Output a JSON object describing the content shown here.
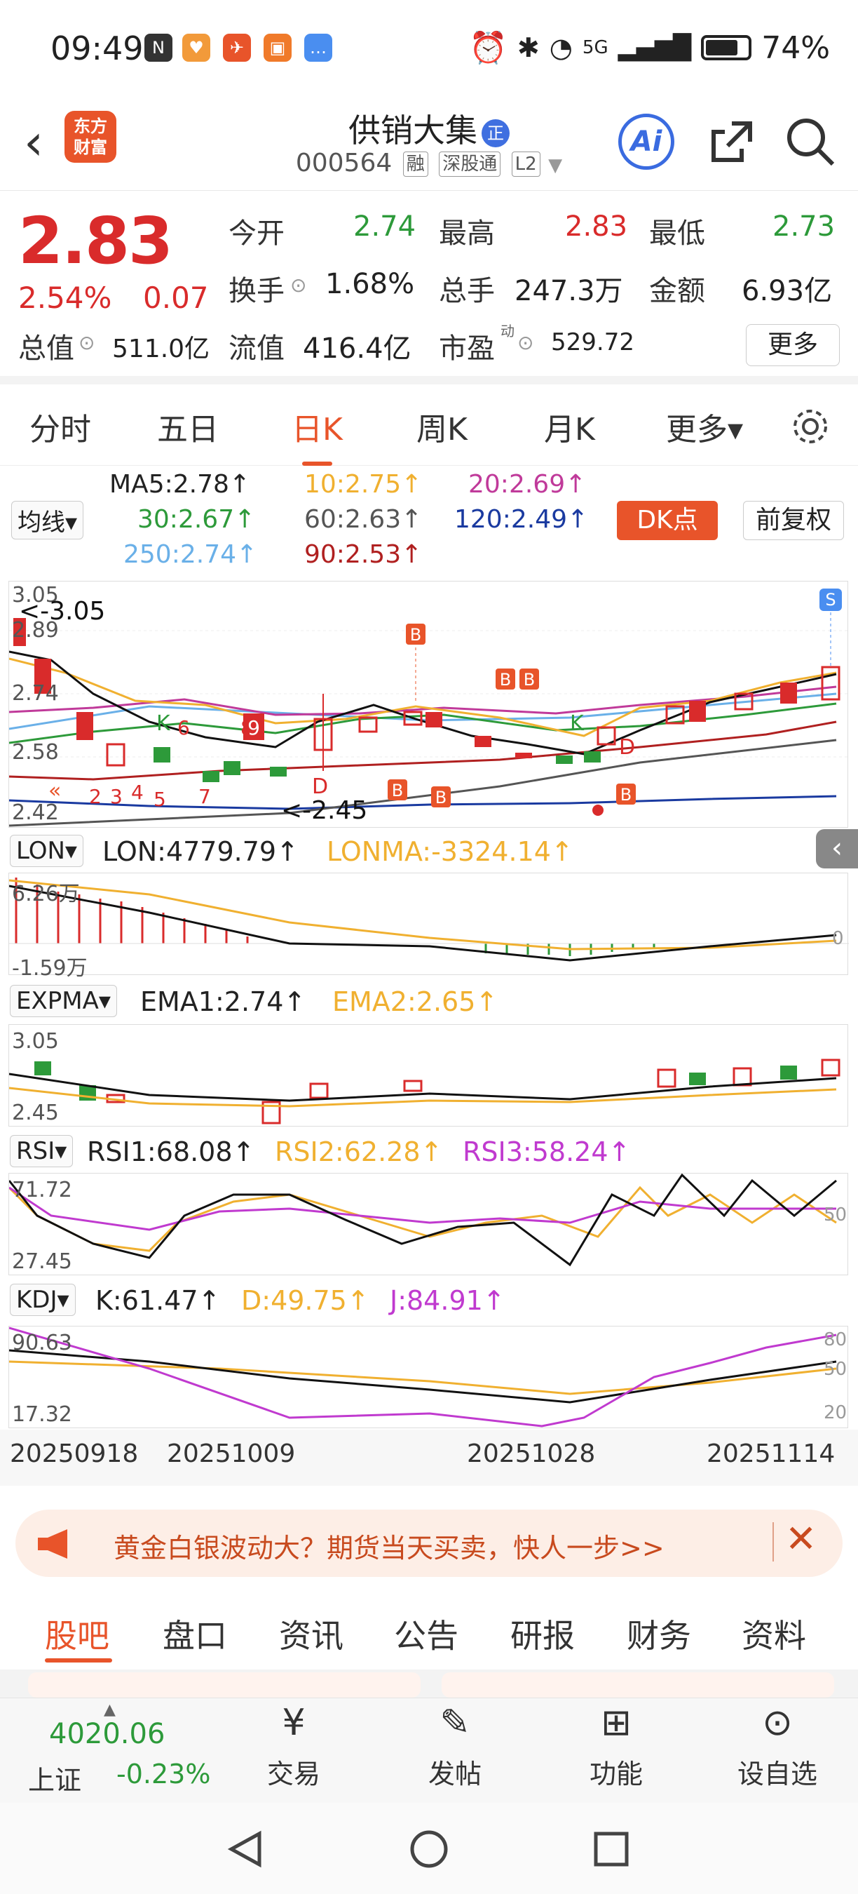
{
  "status_bar": {
    "time": "09:49",
    "network": "5G",
    "battery": "74%"
  },
  "header": {
    "back": "<",
    "logo": "东方\n财富",
    "stock_name": "供销大集",
    "badge": "正",
    "code": "000564",
    "tags": [
      "融",
      "深股通",
      "L2"
    ],
    "ai": "Ai"
  },
  "quote": {
    "price": "2.83",
    "change_pct": "2.54%",
    "change_amt": "0.07",
    "open_label": "今开",
    "open": "2.74",
    "high_label": "最高",
    "high": "2.83",
    "low_label": "最低",
    "low": "2.73",
    "turnover_label": "换手",
    "turnover": "1.68%",
    "volume_label": "总手",
    "volume": "247.3万",
    "amount_label": "金额",
    "amount": "6.93亿",
    "mcap_label": "总值",
    "mcap": "511.0亿",
    "float_label": "流值",
    "float": "416.4亿",
    "pe_label": "市盈",
    "pe_sup": "动",
    "pe": "529.72",
    "more": "更多"
  },
  "period_tabs": [
    "分时",
    "五日",
    "日K",
    "周K",
    "月K",
    "更多▾"
  ],
  "ma": {
    "selector": "均线▾",
    "ma5": "MA5:2.78↑",
    "ma10": "10:2.75↑",
    "ma20": "20:2.69↑",
    "ma30": "30:2.67↑",
    "ma60": "60:2.63↑",
    "ma120": "120:2.49↑",
    "ma250": "250:2.74↑",
    "ma90": "90:2.53↑",
    "dk": "DK点",
    "fq": "前复权"
  },
  "kline": {
    "y_ticks": [
      "3.05",
      "2.89",
      "2.74",
      "2.58",
      "2.42"
    ],
    "high_mark": "<-3.05",
    "low_mark": "<-2.45",
    "s_mark": "S"
  },
  "lon": {
    "selector": "LON▾",
    "lon": "LON:4779.79↑",
    "lonma": "LONMA:-3324.14↑",
    "top": "6.26万",
    "bottom": "-1.59万",
    "zero": "0"
  },
  "expma": {
    "selector": "EXPMA▾",
    "ema1": "EMA1:2.74↑",
    "ema2": "EMA2:2.65↑",
    "top": "3.05",
    "bottom": "2.45"
  },
  "rsi": {
    "selector": "RSI▾",
    "rsi1": "RSI1:68.08↑",
    "rsi2": "RSI2:62.28↑",
    "rsi3": "RSI3:58.24↑",
    "top": "71.72",
    "bottom": "27.45",
    "mid": "50"
  },
  "kdj": {
    "selector": "KDJ▾",
    "k": "K:61.47↑",
    "d": "D:49.75↑",
    "j": "J:84.91↑",
    "top": "90.63",
    "bottom": "17.32",
    "r80": "80",
    "r50": "50",
    "r20": "20"
  },
  "dates": [
    "20250918",
    "20251009",
    "20251028",
    "20251114"
  ],
  "banner": {
    "text": "黄金白银波动大？期货当天买卖，快人一步>>"
  },
  "bottom_tabs": [
    "股吧",
    "盘口",
    "资讯",
    "公告",
    "研报",
    "财务",
    "资料"
  ],
  "footer": {
    "index_value": "4020.06",
    "index_name": "上证",
    "index_change": "-0.23%",
    "items": [
      "交易",
      "发帖",
      "功能",
      "设自选"
    ]
  }
}
